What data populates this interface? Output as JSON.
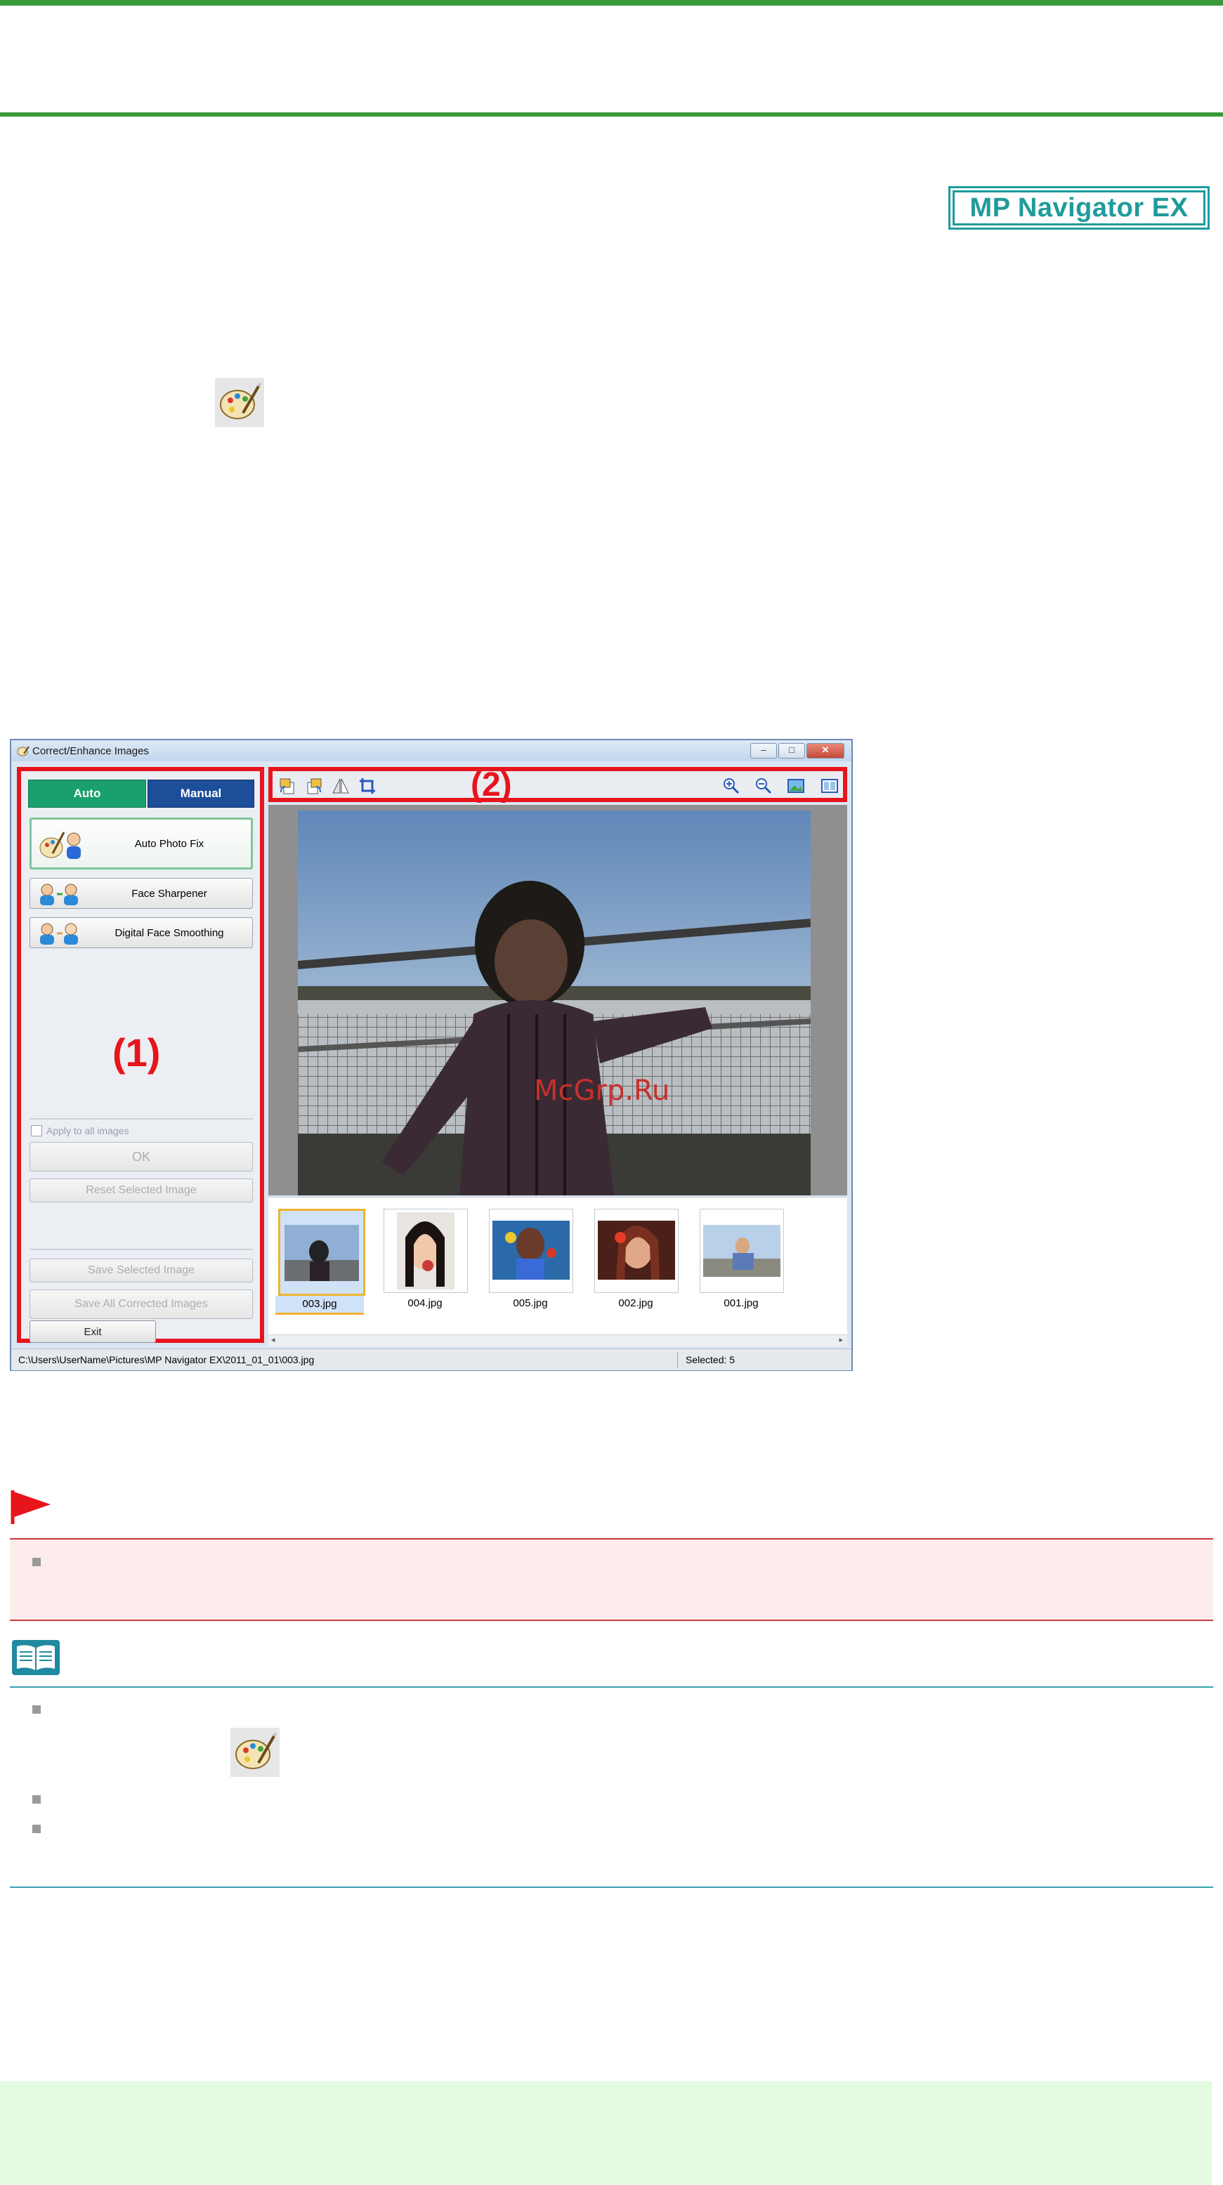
{
  "product_badge": "MP Navigator EX",
  "icons": {
    "palette": "palette-icon",
    "important": "red-flag-icon",
    "note": "open-book-icon"
  },
  "window": {
    "title": "Correct/Enhance Images",
    "tabs": [
      "Auto",
      "Manual"
    ],
    "buttons": {
      "auto_photo_fix": "Auto Photo Fix",
      "face_sharpener": "Face Sharpener",
      "digital_face_smoothing": "Digital Face Smoothing",
      "apply_all": "Apply to all images",
      "ok": "OK",
      "reset": "Reset Selected Image",
      "save_selected": "Save Selected Image",
      "save_all": "Save All Corrected Images",
      "exit": "Exit"
    },
    "callouts": [
      "(1)",
      "(2)"
    ],
    "thumbnails": [
      "003.jpg",
      "004.jpg",
      "005.jpg",
      "002.jpg",
      "001.jpg"
    ],
    "selected_thumbnail": "003.jpg",
    "status_path": "C:\\Users\\UserName\\Pictures\\MP Navigator EX\\2011_01_01\\003.jpg",
    "status_selected": "Selected: 5"
  },
  "watermark": "McGrp.Ru",
  "colors": {
    "green_rule": "#3a9a3a",
    "callout_red": "#e8141c",
    "badge_teal": "#1f9b9b",
    "tab_auto": "#1aa06c",
    "tab_manual": "#1d4e9a"
  }
}
